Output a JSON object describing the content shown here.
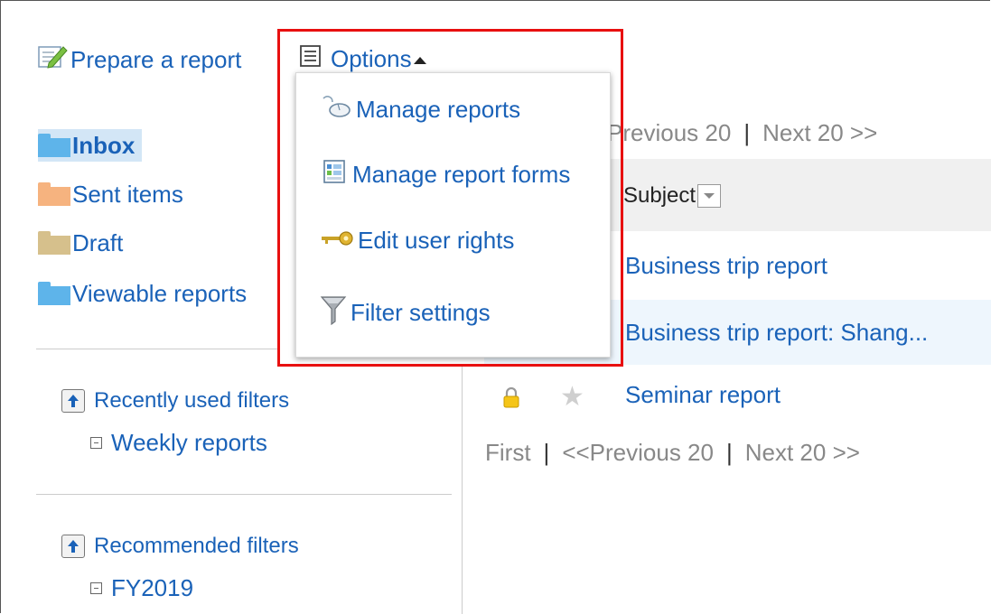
{
  "toolbar": {
    "prepare_label": "Prepare a report",
    "options_label": "Options"
  },
  "folders": [
    {
      "label": "Inbox",
      "color": "#5eb4ea"
    },
    {
      "label": "Sent items",
      "color": "#f6b37f"
    },
    {
      "label": "Draft",
      "color": "#d6c08c"
    },
    {
      "label": "Viewable reports",
      "color": "#5eb4ea"
    }
  ],
  "filters": {
    "recent_heading": "Recently used filters",
    "recent_items": [
      "Weekly reports"
    ],
    "recommended_heading": "Recommended filters",
    "recommended_items": [
      "FY2019"
    ]
  },
  "list": {
    "pager_top": {
      "previous": "Previous 20",
      "separator": "|",
      "next": "Next 20 >>"
    },
    "subject_header": "Subject",
    "rows": [
      {
        "subject": "Business trip report"
      },
      {
        "subject": "Business trip report: Shang..."
      },
      {
        "subject": "Seminar report"
      }
    ],
    "pager_bottom": {
      "first": "First",
      "separator": "|",
      "previous": "<<Previous 20",
      "next": "Next 20 >>"
    }
  },
  "options_menu": {
    "items": [
      {
        "label": "Manage reports",
        "icon": "mouse-icon"
      },
      {
        "label": "Manage report forms",
        "icon": "form-icon"
      },
      {
        "label": "Edit user rights",
        "icon": "key-icon"
      },
      {
        "label": "Filter settings",
        "icon": "funnel-icon"
      }
    ]
  },
  "colors": {
    "link": "#1a62b8",
    "highlight": "#e81010",
    "inbox_bg": "#d3e6f6",
    "row_alt_bg": "#eef6fd"
  }
}
